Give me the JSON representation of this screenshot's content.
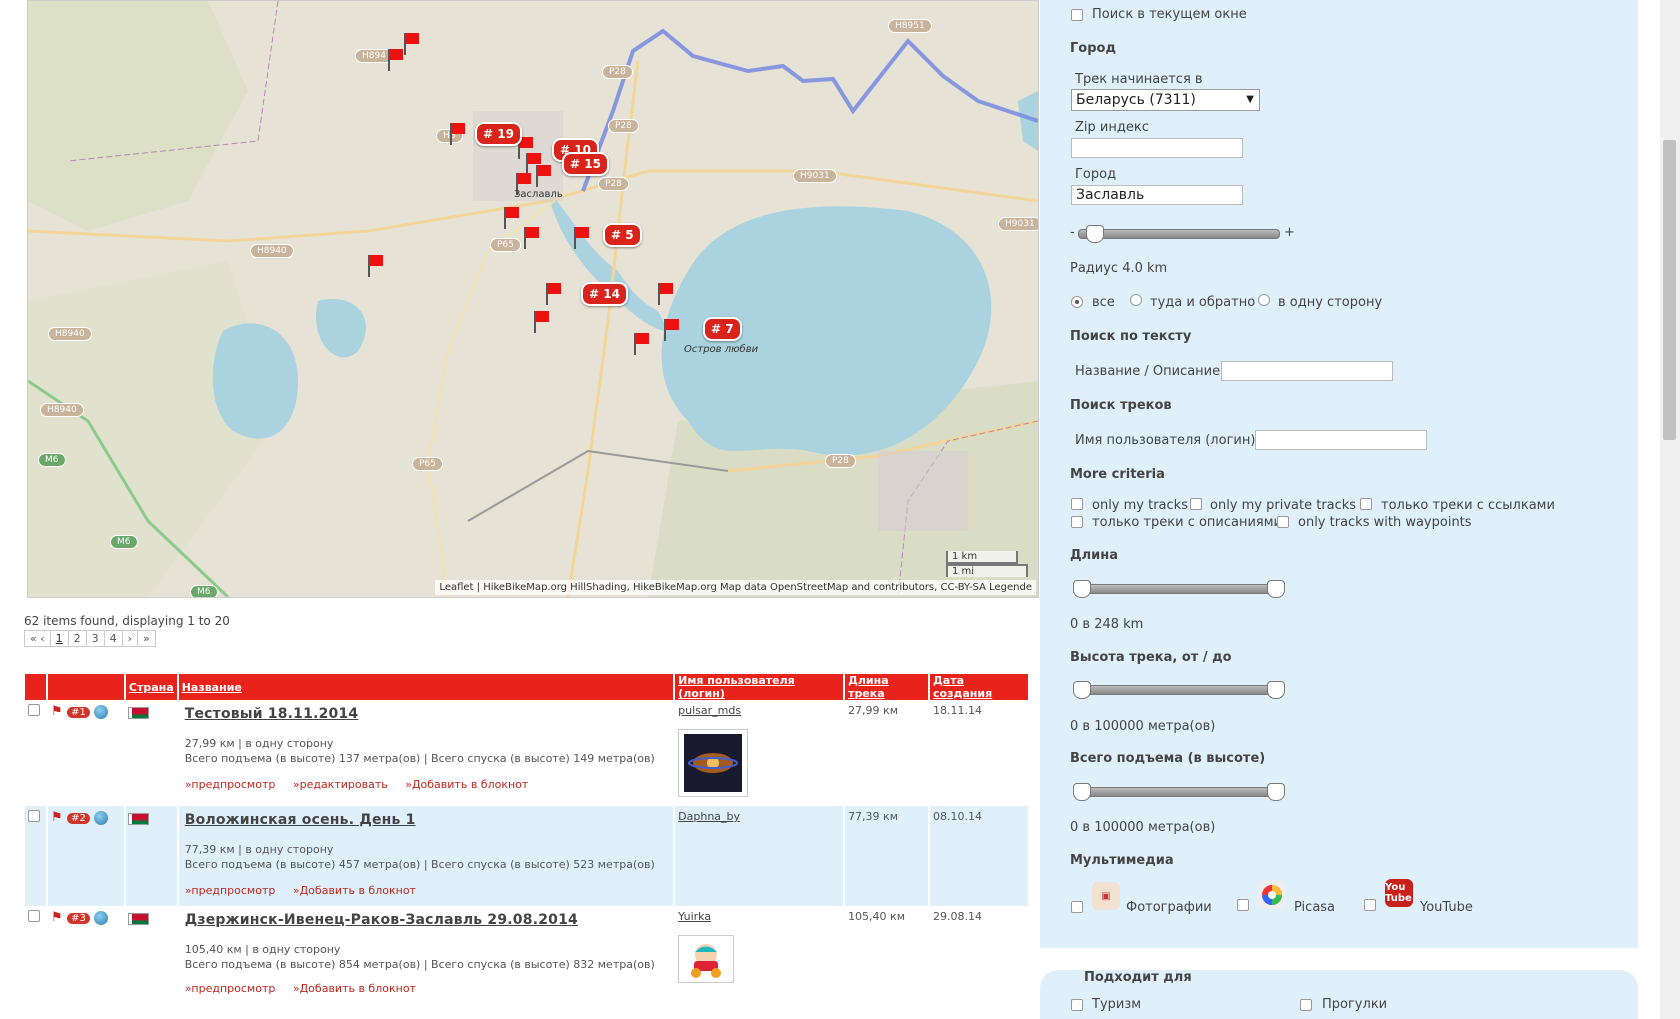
{
  "map": {
    "attribution": "Leaflet | HikeBikeMap.org HillShading, HikeBikeMap.org Map data OpenStreetMap and contributors, CC-BY-SA Legende",
    "scale_km": "1 km",
    "scale_mi": "1 mi",
    "town_label": "Заславль",
    "island_label": "Остров любви",
    "road_labels": [
      "H8951",
      "P28",
      "P28",
      "P28",
      "H9031",
      "H9031",
      "P65",
      "P65",
      "H8940",
      "H8940",
      "H8940",
      "M6",
      "M6",
      "M6",
      "P28",
      "H894",
      "H8"
    ],
    "clusters": [
      "# 19",
      "# 10",
      "# 15",
      "# 5",
      "# 14",
      "# 7"
    ]
  },
  "results": {
    "items_found": "62 items found, displaying 1 to 20",
    "pager": [
      "« ‹",
      "1",
      "2",
      "3",
      "4",
      "›",
      "»"
    ],
    "columns": [
      "Страна",
      "Название",
      "Имя пользователя (логин)",
      "Длина трека",
      "Дата создания"
    ],
    "rows": [
      {
        "num": "#1",
        "title": "Тестовый 18.11.2014",
        "stats1": "27,99 км | в одну сторону",
        "stats2": "Всего подъема (в высоте) 137 метра(ов) | Всего спуска (в высоте) 149 метра(ов)",
        "links": [
          "»предпросмотр",
          "»редактировать",
          "»Добавить в блокнот"
        ],
        "user": "pulsar_mds",
        "length": "27,99 км",
        "date": "18.11.14"
      },
      {
        "num": "#2",
        "title": "Воложинская осень. День 1",
        "stats1": "77,39 км | в одну сторону",
        "stats2": "Всего подъема (в высоте) 457 метра(ов) | Всего спуска (в высоте) 523 метра(ов)",
        "links": [
          "»предпросмотр",
          "»Добавить в блокнот"
        ],
        "user": "Daphna_by",
        "length": "77,39 км",
        "date": "08.10.14"
      },
      {
        "num": "#3",
        "title": "Дзержинск-Ивенец-Раков-Заславль 29.08.2014",
        "stats1": "105,40 км | в одну сторону",
        "stats2": "Всего подъема (в высоте) 854 метра(ов) | Всего спуска (в высоте) 832 метра(ов)",
        "links": [
          "»предпросмотр",
          "»Добавить в блокнот"
        ],
        "user": "Yuirka",
        "length": "105,40 км",
        "date": "29.08.14"
      }
    ]
  },
  "sidebar": {
    "search_current_window": "Поиск в текущем окне",
    "city_header": "Город",
    "track_starts_in": "Трек начинается в",
    "country_selected": "Беларусь (7311)",
    "zip_label": "Zip индекс",
    "zip_value": "",
    "city_label": "Город",
    "city_value": "Заславль",
    "radius_minus": "-",
    "radius_plus": "+",
    "radius_text": "Радиус 4.0 km",
    "radius_level": 0.04,
    "direction_options": [
      "все",
      "туда и обратно",
      "в одну сторону"
    ],
    "text_search_header": "Поиск по тексту",
    "name_desc_label": "Название / Описание",
    "track_search_header": "Поиск треков",
    "username_label": "Имя пользователя (логин)",
    "more_criteria_header": "More criteria",
    "criteria": [
      "only my tracks",
      "only my private tracks",
      "только треки с ссылками",
      "только треки с описаниями",
      "only tracks with waypoints"
    ],
    "length_header": "Длина",
    "length_text": "0 в 248 km",
    "altitude_header": "Высота трека, от / до",
    "altitude_text": "0 в 100000 метра(ов)",
    "ascent_header": "Всего подъема (в высоте)",
    "ascent_text": "0 в 100000 метра(ов)",
    "multimedia_header": "Мультимедиа",
    "media": [
      "Фотографии",
      "Picasa",
      "YouTube"
    ],
    "youtube_icon_text": "You Tube",
    "suitable_header": "Подходит для",
    "suitable_options": [
      "Туризм",
      "Прогулки"
    ]
  },
  "colors": {
    "accent_red": "#e8231b",
    "panel_blue": "#dff0fb",
    "link_red": "#c0271d",
    "map_lake": "#aad3df",
    "route_blue": "#7b8fe0"
  }
}
